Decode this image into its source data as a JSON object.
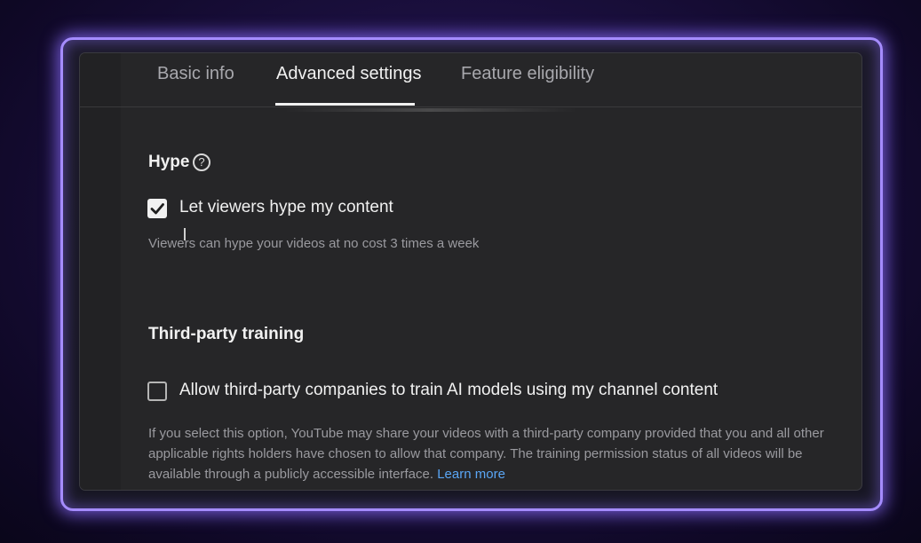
{
  "tabs": [
    {
      "label": "Basic info",
      "active": false
    },
    {
      "label": "Advanced settings",
      "active": true
    },
    {
      "label": "Feature eligibility",
      "active": false
    }
  ],
  "hype": {
    "title": "Hype",
    "help_icon": "?",
    "checkbox_label": "Let viewers hype my content",
    "checked": true,
    "description": "Viewers can hype your videos at no cost 3 times a week"
  },
  "third_party": {
    "title": "Third-party training",
    "checkbox_label": "Allow third-party companies to train AI models using my channel content",
    "checked": false,
    "description": "If you select this option, YouTube may share your videos with a third-party company provided that you and all other applicable rights holders have chosen to allow that company. The training permission status of all videos will be available through a publicly accessible interface.",
    "link_text": "Learn more"
  },
  "colors": {
    "accent_glow": "#a58cff",
    "link": "#5aa6f5",
    "panel_bg": "#262628"
  }
}
